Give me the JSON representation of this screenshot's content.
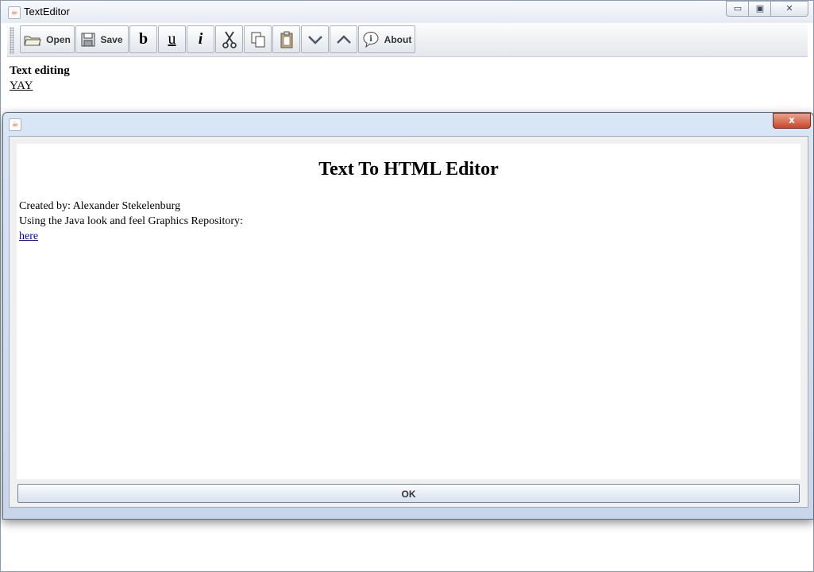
{
  "main_window": {
    "title": "TextEditor",
    "controls": {
      "minimize": "▭",
      "maximize": "▣",
      "close": "✕"
    }
  },
  "toolbar": {
    "open_label": "Open",
    "save_label": "Save",
    "bold_label": "b",
    "underline_label": "u",
    "italic_label": "i",
    "about_label": "About",
    "icons": [
      "folder-icon",
      "floppy-disk-icon",
      "scissors-icon",
      "copy-icon",
      "clipboard-icon",
      "chevron-down-icon",
      "chevron-up-icon",
      "info-bubble-icon"
    ]
  },
  "editor": {
    "line1": "Text editing",
    "line2": "YAY"
  },
  "dialog": {
    "close": "x",
    "heading": "Text To HTML Editor",
    "line1": "Created by: Alexander Stekelenburg",
    "line2": "Using the Java look and feel Graphics Repository:",
    "link": "here",
    "ok_label": "OK"
  },
  "colors": {
    "link": "#0000cc",
    "dialog_close": "#c8462b",
    "java_icon": "#d9541e"
  }
}
